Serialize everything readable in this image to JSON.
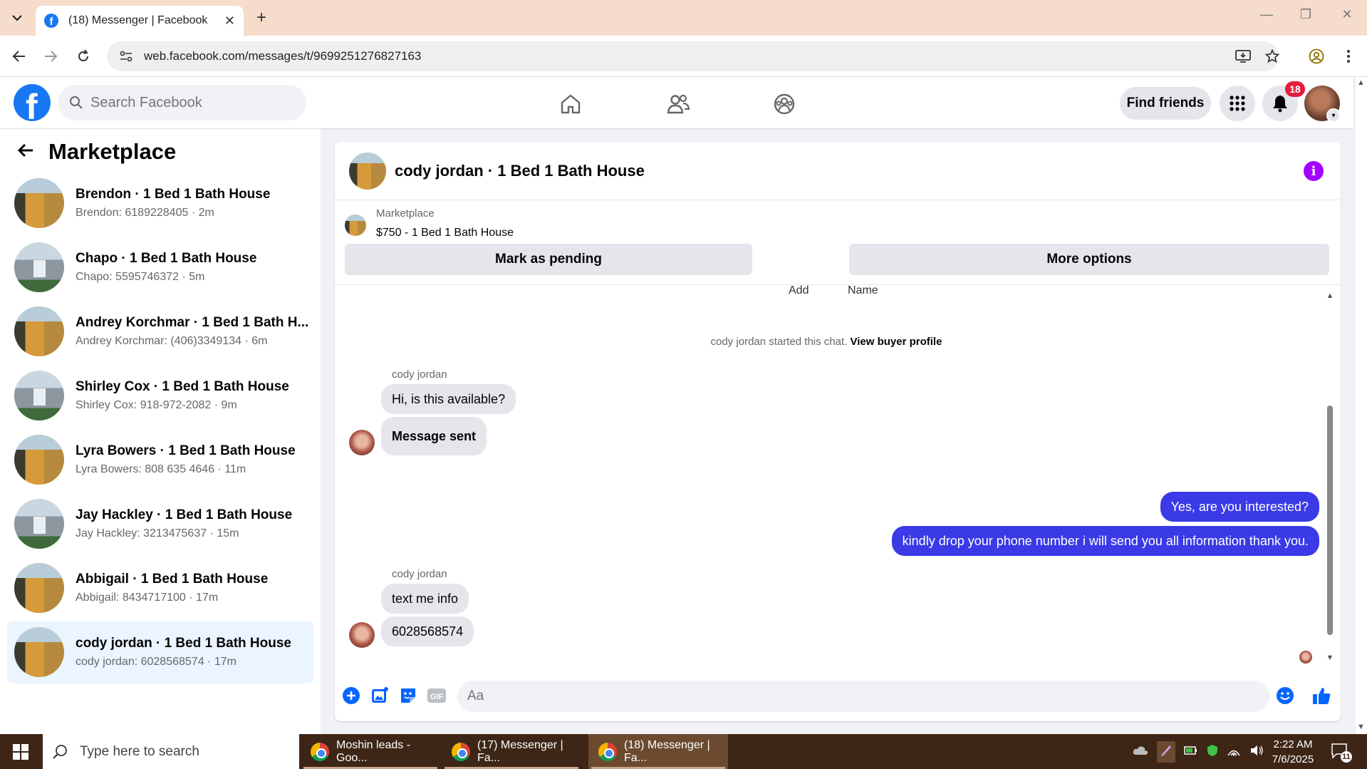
{
  "browser": {
    "tab_title": "(18) Messenger | Facebook",
    "url": "web.facebook.com/messages/t/9699251276827163"
  },
  "fb": {
    "search_placeholder": "Search Facebook",
    "find_friends": "Find friends",
    "notification_count": "18"
  },
  "sidebar": {
    "title": "Marketplace",
    "conversations": [
      {
        "title": "Brendon · 1 Bed 1 Bath House",
        "sub": "Brendon: 6189228405 · 2m",
        "thumb": "house-a"
      },
      {
        "title": "Chapo · 1 Bed 1 Bath House",
        "sub": "Chapo: 5595746372 · 5m",
        "thumb": "house-b"
      },
      {
        "title": "Andrey Korchmar · 1 Bed 1 Bath H...",
        "sub": "Andrey Korchmar: (406)3349134 · 6m",
        "thumb": "house-a"
      },
      {
        "title": "Shirley Cox · 1 Bed 1 Bath House",
        "sub": "Shirley Cox: 918-972-2082 · 9m",
        "thumb": "house-b"
      },
      {
        "title": "Lyra Bowers · 1 Bed 1 Bath House",
        "sub": "Lyra Bowers: 808 635 4646 · 11m",
        "thumb": "house-a"
      },
      {
        "title": "Jay Hackley · 1 Bed 1 Bath House",
        "sub": "Jay Hackley: 3213475637 · 15m",
        "thumb": "house-b"
      },
      {
        "title": "Abbigail · 1 Bed 1 Bath House",
        "sub": "Abbigail: 8434717100 · 17m",
        "thumb": "house-a"
      },
      {
        "title": "cody jordan · 1 Bed 1 Bath House",
        "sub": "cody jordan: 6028568574 · 17m",
        "thumb": "house-a",
        "active": true
      }
    ]
  },
  "chat": {
    "title": "cody jordan · 1 Bed 1 Bath House",
    "listing_label": "Marketplace",
    "listing_price": "$750 - 1 Bed 1 Bath House",
    "mark_pending": "Mark as pending",
    "more_options": "More options",
    "cut_add": "Add",
    "cut_name": "Name",
    "system_text": "cody jordan started this chat.",
    "system_link": "View buyer profile",
    "sender": "cody jordan",
    "messages": {
      "m1": "Hi, is this available?",
      "m2": "Message sent",
      "m3": "Yes, are you interested?",
      "m4": "kindly drop your phone number i will send you all information thank you.",
      "m5": "text me info",
      "m6": "6028568574"
    },
    "composer_placeholder": "Aa"
  },
  "taskbar": {
    "search_placeholder": "Type here to search",
    "apps": [
      "Moshin leads - Goo...",
      "(17) Messenger | Fa...",
      "(18) Messenger | Fa..."
    ],
    "time": "2:22 AM",
    "date": "7/6/2025",
    "notification_count": "11"
  },
  "colors": {
    "facebook_blue": "#1877f2",
    "outgoing_bubble": "#3a3ae6",
    "info_purple": "#a200ff",
    "badge_red": "#e41e3f"
  }
}
